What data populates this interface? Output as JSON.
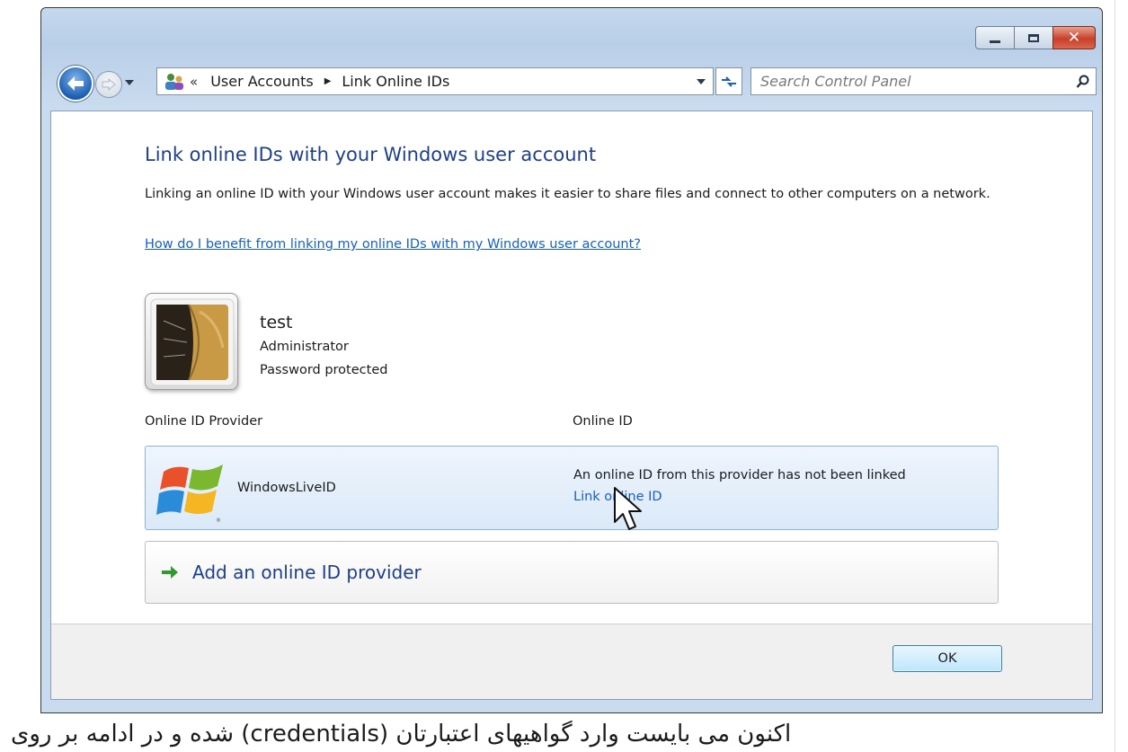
{
  "window": {
    "controls": {
      "minimize": "minimize",
      "maximize": "maximize",
      "close": "close"
    }
  },
  "nav": {
    "breadcrumb": [
      "User Accounts",
      "Link Online IDs"
    ],
    "chevron": "«",
    "search_placeholder": "Search Control Panel",
    "icons": {
      "back": "back-arrow-icon",
      "forward": "forward-arrow-icon",
      "refresh": "refresh-icon",
      "search": "search-icon",
      "location": "user-accounts-icon"
    }
  },
  "content": {
    "title": "Link online IDs with your Windows user account",
    "description": "Linking an online ID with your Windows user account makes it easier to share files and connect to other computers on a network.",
    "help_link": "How do I benefit from linking my online IDs with my Windows user account?",
    "user": {
      "name": "test",
      "role": "Administrator",
      "status": "Password protected"
    },
    "columns": {
      "provider": "Online ID Provider",
      "online_id": "Online ID"
    },
    "providers": [
      {
        "name": "WindowsLiveID",
        "status": "An online ID from this provider has not been linked",
        "action": "Link online ID"
      }
    ],
    "add_provider": "Add an online ID provider"
  },
  "footer": {
    "ok_label": "OK"
  },
  "caption": "اکنون می بایست وارد گواهیهای اعتبارتان (credentials) شده و در ادامه بر روی",
  "colors": {
    "title_blue": "#1e3f8c",
    "link_blue": "#1560c9",
    "row_highlight": "#dbe9f8",
    "frame": "#c4d8ed"
  }
}
